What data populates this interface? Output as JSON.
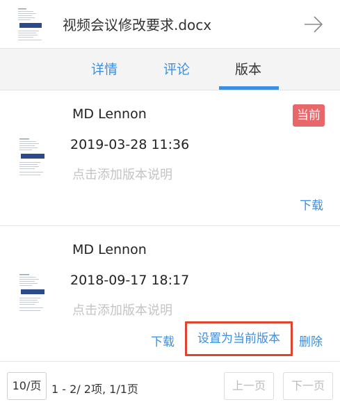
{
  "document": {
    "title": "视频会议修改要求.docx",
    "thumbnail_icon": "document-thumbnail",
    "forward_icon": "arrow-right-icon"
  },
  "tabs": [
    {
      "label": "详情",
      "active": false
    },
    {
      "label": "评论",
      "active": false
    },
    {
      "label": "版本",
      "active": true
    }
  ],
  "versions": [
    {
      "author": "MD Lennon",
      "date": "2019-03-28 11:36",
      "note_placeholder": "点击添加版本说明",
      "badge": "当前",
      "actions": {
        "download": "下载"
      }
    },
    {
      "author": "MD Lennon",
      "date": "2018-09-17 18:17",
      "note_placeholder": "点击添加版本说明",
      "actions": {
        "download": "下载",
        "set_current": "设置为当前版本",
        "delete": "删除"
      }
    }
  ],
  "pagination": {
    "page_size": "10/页",
    "info": "1 - 2/ 2项, 1/1页",
    "prev": "上一页",
    "next": "下一页"
  },
  "colors": {
    "accent": "#3b8ee0",
    "badge": "#e8676a",
    "highlight": "#e0442e"
  }
}
